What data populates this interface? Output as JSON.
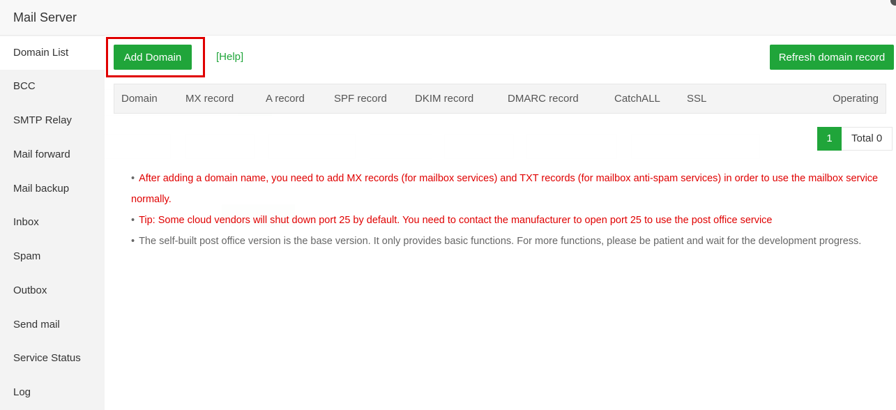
{
  "window": {
    "title": "Mail Server"
  },
  "sidebar": {
    "items": [
      {
        "label": "Domain List",
        "active": true
      },
      {
        "label": "BCC"
      },
      {
        "label": "SMTP Relay"
      },
      {
        "label": "Mail forward"
      },
      {
        "label": "Mail backup"
      },
      {
        "label": "Inbox"
      },
      {
        "label": "Spam"
      },
      {
        "label": "Outbox"
      },
      {
        "label": "Send mail"
      },
      {
        "label": "Service Status"
      },
      {
        "label": "Log"
      }
    ]
  },
  "toolbar": {
    "add_label": "Add Domain",
    "help_label": "[Help]",
    "refresh_label": "Refresh domain record"
  },
  "table": {
    "columns": [
      "Domain",
      "MX record",
      "A record",
      "SPF record",
      "DKIM record",
      "DMARC record",
      "CatchALL",
      "SSL",
      "Operating"
    ]
  },
  "pagination": {
    "page": "1",
    "total": "Total 0"
  },
  "tips": [
    "After adding a domain name, you need to add MX records (for mailbox services) and TXT records (for mailbox anti-spam services) in order to use the mailbox service normally.",
    "Tip: Some cloud vendors will shut down port 25 by default. You need to contact the manufacturer to open port 25 to use the post office service",
    "The self-built post office version is the base version. It only provides basic functions. For more functions, please be patient and wait for the development progress."
  ],
  "colors": {
    "accent": "#20a53a",
    "danger": "#e00000",
    "highlight": "#e00000"
  }
}
